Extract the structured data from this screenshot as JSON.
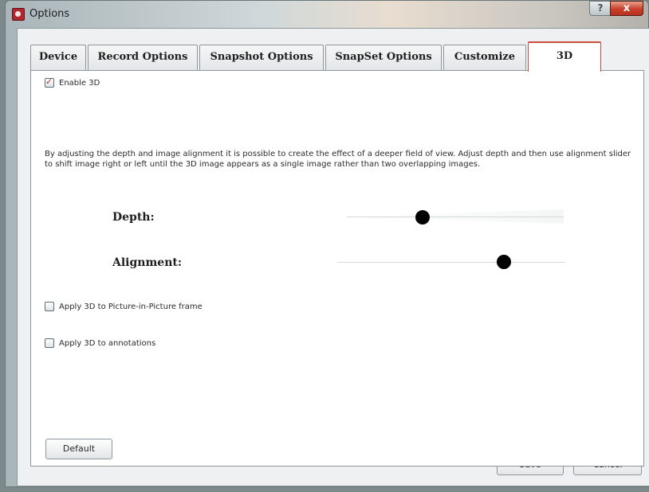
{
  "window": {
    "title": "Options",
    "help_label": "?",
    "close_label": "x"
  },
  "tabs": [
    {
      "label": "Device"
    },
    {
      "label": "Record Options"
    },
    {
      "label": "Snapshot Options"
    },
    {
      "label": "SnapSet Options"
    },
    {
      "label": "Customize"
    },
    {
      "label": "3D",
      "active": true
    }
  ],
  "panel": {
    "enable_3d": {
      "label": "Enable 3D",
      "checked": true
    },
    "description": "By adjusting the depth and image alignment it is possible to create the effect of a deeper field of view. Adjust depth and then use alignment slider to shift image right or left until the 3D image appears as a single image rather than two overlapping images.",
    "depth": {
      "label": "Depth:",
      "value_fraction": 0.35
    },
    "alignment": {
      "label": "Alignment:",
      "value_fraction": 0.73
    },
    "apply_pip": {
      "label": "Apply 3D to Picture-in-Picture frame",
      "checked": false
    },
    "apply_annotations": {
      "label": "Apply 3D to annotations",
      "checked": false
    },
    "default_label": "Default"
  },
  "footer": {
    "save_label": "Save",
    "cancel_label": "Cancel"
  },
  "colors": {
    "active_tab_accent": "#c84d3f",
    "close_button": "#c8402b",
    "slider_thumb": "#000000"
  }
}
